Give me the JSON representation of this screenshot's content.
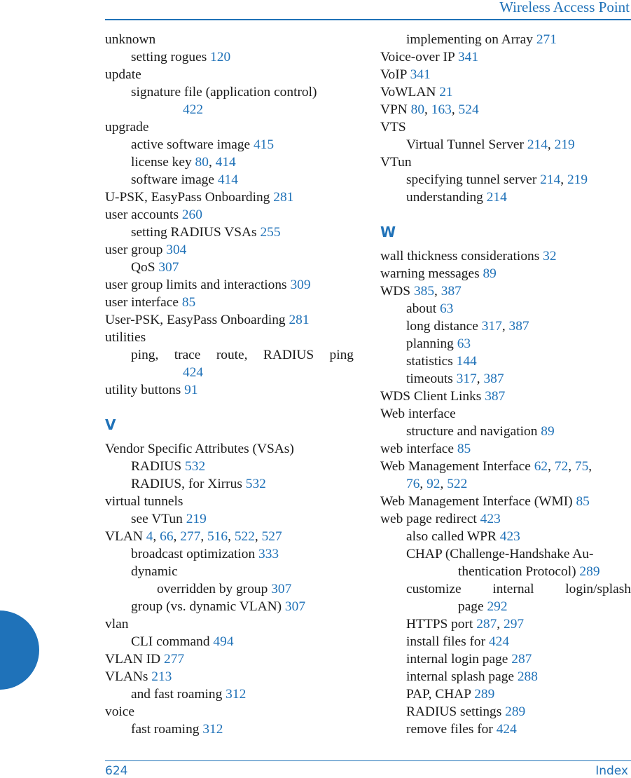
{
  "header": {
    "title": "Wireless Access Point"
  },
  "footer": {
    "page_number": "624",
    "section": "Index"
  },
  "colors": {
    "accent": "#2072b8",
    "text": "#1a1a1a"
  },
  "left_column": [
    {
      "type": "entry",
      "level": 1,
      "text": "unknown",
      "pages": []
    },
    {
      "type": "entry",
      "level": 2,
      "text": "setting rogues",
      "pages": [
        "120"
      ]
    },
    {
      "type": "entry",
      "level": 1,
      "text": "update",
      "pages": []
    },
    {
      "type": "entry",
      "level": 2,
      "text": "signature file (application control)",
      "pages": [
        "422"
      ],
      "wrap": true
    },
    {
      "type": "entry",
      "level": 1,
      "text": "upgrade",
      "pages": []
    },
    {
      "type": "entry",
      "level": 2,
      "text": "active software image",
      "pages": [
        "415"
      ]
    },
    {
      "type": "entry",
      "level": 2,
      "text": "license key",
      "pages": [
        "80",
        "414"
      ]
    },
    {
      "type": "entry",
      "level": 2,
      "text": "software image",
      "pages": [
        "414"
      ]
    },
    {
      "type": "entry",
      "level": 1,
      "text": "U-PSK, EasyPass Onboarding",
      "pages": [
        "281"
      ]
    },
    {
      "type": "entry",
      "level": 1,
      "text": "user accounts",
      "pages": [
        "260"
      ]
    },
    {
      "type": "entry",
      "level": 2,
      "text": "setting RADIUS VSAs",
      "pages": [
        "255"
      ]
    },
    {
      "type": "entry",
      "level": 1,
      "text": "user group",
      "pages": [
        "304"
      ]
    },
    {
      "type": "entry",
      "level": 2,
      "text": "QoS",
      "pages": [
        "307"
      ]
    },
    {
      "type": "entry",
      "level": 1,
      "text": "user group limits and interactions",
      "pages": [
        "309"
      ]
    },
    {
      "type": "entry",
      "level": 1,
      "text": "user interface",
      "pages": [
        "85"
      ]
    },
    {
      "type": "entry",
      "level": 1,
      "text": "User-PSK, EasyPass Onboarding",
      "pages": [
        "281"
      ]
    },
    {
      "type": "entry",
      "level": 1,
      "text": "utilities",
      "pages": []
    },
    {
      "type": "entry",
      "level": 2,
      "text": "ping, trace route, RADIUS ping",
      "pages": [
        "424"
      ],
      "wrap": true,
      "justify": true
    },
    {
      "type": "entry",
      "level": 1,
      "text": "utility buttons",
      "pages": [
        "91"
      ]
    },
    {
      "type": "letter",
      "text": "V"
    },
    {
      "type": "entry",
      "level": 1,
      "text": "Vendor Specific Attributes (VSAs)",
      "pages": []
    },
    {
      "type": "entry",
      "level": 2,
      "text": "RADIUS",
      "pages": [
        "532"
      ]
    },
    {
      "type": "entry",
      "level": 2,
      "text": "RADIUS, for Xirrus",
      "pages": [
        "532"
      ]
    },
    {
      "type": "entry",
      "level": 1,
      "text": "virtual tunnels",
      "pages": []
    },
    {
      "type": "entry",
      "level": 2,
      "text": "see VTun",
      "pages": [
        "219"
      ]
    },
    {
      "type": "entry",
      "level": 1,
      "text": "VLAN",
      "pages": [
        "4",
        "66",
        "277",
        "516",
        "522",
        "527"
      ]
    },
    {
      "type": "entry",
      "level": 2,
      "text": "broadcast optimization",
      "pages": [
        "333"
      ]
    },
    {
      "type": "entry",
      "level": 2,
      "text": "dynamic",
      "pages": []
    },
    {
      "type": "entry",
      "level": 3,
      "text": "overridden by group",
      "pages": [
        "307"
      ]
    },
    {
      "type": "entry",
      "level": 2,
      "text": "group (vs. dynamic VLAN)",
      "pages": [
        "307"
      ]
    },
    {
      "type": "entry",
      "level": 1,
      "text": "vlan",
      "pages": []
    },
    {
      "type": "entry",
      "level": 2,
      "text": "CLI command",
      "pages": [
        "494"
      ]
    },
    {
      "type": "entry",
      "level": 1,
      "text": "VLAN ID",
      "pages": [
        "277"
      ]
    },
    {
      "type": "entry",
      "level": 1,
      "text": "VLANs",
      "pages": [
        "213"
      ]
    },
    {
      "type": "entry",
      "level": 2,
      "text": "and fast roaming",
      "pages": [
        "312"
      ]
    },
    {
      "type": "entry",
      "level": 1,
      "text": "voice",
      "pages": []
    },
    {
      "type": "entry",
      "level": 2,
      "text": "fast roaming",
      "pages": [
        "312"
      ]
    }
  ],
  "right_column": [
    {
      "type": "entry",
      "level": 2,
      "text": "implementing on Array",
      "pages": [
        "271"
      ]
    },
    {
      "type": "entry",
      "level": 1,
      "text": "Voice-over IP",
      "pages": [
        "341"
      ]
    },
    {
      "type": "entry",
      "level": 1,
      "text": "VoIP",
      "pages": [
        "341"
      ]
    },
    {
      "type": "entry",
      "level": 1,
      "text": "VoWLAN",
      "pages": [
        "21"
      ]
    },
    {
      "type": "entry",
      "level": 1,
      "text": "VPN",
      "pages": [
        "80",
        "163",
        "524"
      ]
    },
    {
      "type": "entry",
      "level": 1,
      "text": "VTS",
      "pages": []
    },
    {
      "type": "entry",
      "level": 2,
      "text": "Virtual Tunnel Server",
      "pages": [
        "214",
        "219"
      ]
    },
    {
      "type": "entry",
      "level": 1,
      "text": "VTun",
      "pages": []
    },
    {
      "type": "entry",
      "level": 2,
      "text": "specifying tunnel server",
      "pages": [
        "214",
        "219"
      ]
    },
    {
      "type": "entry",
      "level": 2,
      "text": "understanding",
      "pages": [
        "214"
      ]
    },
    {
      "type": "letter",
      "text": "W"
    },
    {
      "type": "entry",
      "level": 1,
      "text": "wall thickness considerations",
      "pages": [
        "32"
      ]
    },
    {
      "type": "entry",
      "level": 1,
      "text": "warning messages",
      "pages": [
        "89"
      ]
    },
    {
      "type": "entry",
      "level": 1,
      "text": "WDS",
      "pages": [
        "385",
        "387"
      ]
    },
    {
      "type": "entry",
      "level": 2,
      "text": "about",
      "pages": [
        "63"
      ]
    },
    {
      "type": "entry",
      "level": 2,
      "text": "long distance",
      "pages": [
        "317",
        "387"
      ]
    },
    {
      "type": "entry",
      "level": 2,
      "text": "planning",
      "pages": [
        "63"
      ]
    },
    {
      "type": "entry",
      "level": 2,
      "text": "statistics",
      "pages": [
        "144"
      ]
    },
    {
      "type": "entry",
      "level": 2,
      "text": "timeouts",
      "pages": [
        "317",
        "387"
      ]
    },
    {
      "type": "entry",
      "level": 1,
      "text": "WDS Client Links",
      "pages": [
        "387"
      ]
    },
    {
      "type": "entry",
      "level": 1,
      "text": "Web interface",
      "pages": []
    },
    {
      "type": "entry",
      "level": 2,
      "text": "structure and navigation",
      "pages": [
        "89"
      ]
    },
    {
      "type": "entry",
      "level": 1,
      "text": "web interface",
      "pages": [
        "85"
      ]
    },
    {
      "type": "entry",
      "level": 1,
      "text": "Web Management Interface",
      "pages": [
        "62",
        "72",
        "75"
      ],
      "cont_pages": [
        "76",
        "92",
        "522"
      ]
    },
    {
      "type": "entry",
      "level": 1,
      "text": "Web Management Interface (WMI)",
      "pages": [
        "85"
      ]
    },
    {
      "type": "entry",
      "level": 1,
      "text": "web page redirect",
      "pages": [
        "423"
      ]
    },
    {
      "type": "entry",
      "level": 2,
      "text": "also called WPR",
      "pages": [
        "423"
      ]
    },
    {
      "type": "entry",
      "level": 2,
      "text": "CHAP (Challenge-Handshake Au-",
      "cont_text": "thentication Protocol)",
      "pages": [
        "289"
      ]
    },
    {
      "type": "entry",
      "level": 2,
      "text": "customize internal login/splash",
      "cont_text": "page",
      "pages": [
        "292"
      ],
      "justify": true
    },
    {
      "type": "entry",
      "level": 2,
      "text": "HTTPS port",
      "pages": [
        "287",
        "297"
      ]
    },
    {
      "type": "entry",
      "level": 2,
      "text": "install files for",
      "pages": [
        "424"
      ]
    },
    {
      "type": "entry",
      "level": 2,
      "text": "internal login page",
      "pages": [
        "287"
      ]
    },
    {
      "type": "entry",
      "level": 2,
      "text": "internal splash page",
      "pages": [
        "288"
      ]
    },
    {
      "type": "entry",
      "level": 2,
      "text": "PAP, CHAP",
      "pages": [
        "289"
      ]
    },
    {
      "type": "entry",
      "level": 2,
      "text": "RADIUS settings",
      "pages": [
        "289"
      ]
    },
    {
      "type": "entry",
      "level": 2,
      "text": "remove files for",
      "pages": [
        "424"
      ]
    }
  ]
}
